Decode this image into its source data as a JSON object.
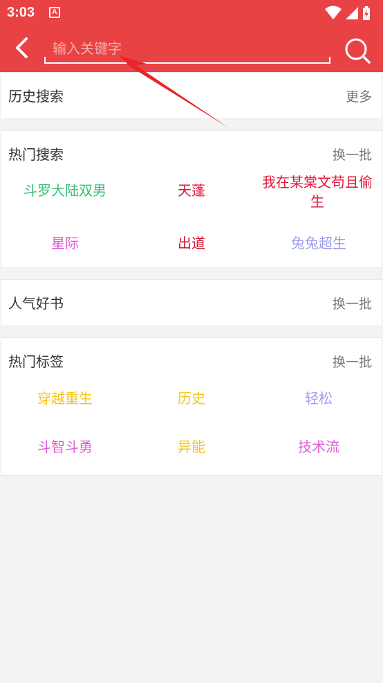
{
  "status_bar": {
    "time": "3:03",
    "notification_glyph": "A"
  },
  "search": {
    "placeholder": "输入关键字"
  },
  "history": {
    "title": "历史搜索",
    "more": "更多"
  },
  "hot_search": {
    "title": "热门搜索",
    "refresh": "换一批",
    "items": [
      {
        "label": "斗罗大陆双男",
        "color": "#3bbf7c"
      },
      {
        "label": "天蓬",
        "color": "#e2163a"
      },
      {
        "label": "我在某棠文苟且偷生",
        "color": "#e2163a"
      },
      {
        "label": "星际",
        "color": "#e05ad7"
      },
      {
        "label": "出道",
        "color": "#d2122e"
      },
      {
        "label": "兔兔超生",
        "color": "#9e9df0"
      }
    ]
  },
  "popular_books": {
    "title": "人气好书",
    "refresh": "换一批"
  },
  "hot_tags": {
    "title": "热门标签",
    "refresh": "换一批",
    "items": [
      {
        "label": "穿越重生",
        "color": "#f5c518"
      },
      {
        "label": "历史",
        "color": "#f5c518"
      },
      {
        "label": "轻松",
        "color": "#9e9df0"
      },
      {
        "label": "斗智斗勇",
        "color": "#e05ad7"
      },
      {
        "label": "异能",
        "color": "#f5c518"
      },
      {
        "label": "技术流",
        "color": "#e05ad7"
      }
    ]
  },
  "colors": {
    "accent": "#e94244",
    "background": "#f3f3f3",
    "annotation_arrow": "#e8262a"
  }
}
